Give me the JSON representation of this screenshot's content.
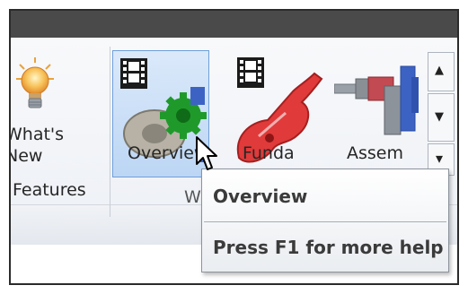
{
  "ribbon": {
    "whats_new_label": "What's\nNew",
    "panels": [
      {
        "label": "Features"
      },
      {
        "label": "W"
      }
    ],
    "tiles": [
      {
        "label": "Overview",
        "selected": true,
        "icon": "overview-gear-assembly-icon"
      },
      {
        "label": "Funda",
        "selected": false,
        "icon": "fundamentals-guitar-icon"
      },
      {
        "label": "Assem",
        "selected": false,
        "icon": "assembly-shaft-icon"
      }
    ],
    "scroll": {
      "up_icon": "▲",
      "down_icon": "▼",
      "more_icon": "▾"
    }
  },
  "tooltip": {
    "title": "Overview",
    "help": "Press F1 for more help"
  },
  "colors": {
    "titlebar": "#4a4a4a",
    "selected_tile": "#bcd6f4",
    "gear_green": "#1f9a2a",
    "guitar_red": "#e03a3a"
  }
}
